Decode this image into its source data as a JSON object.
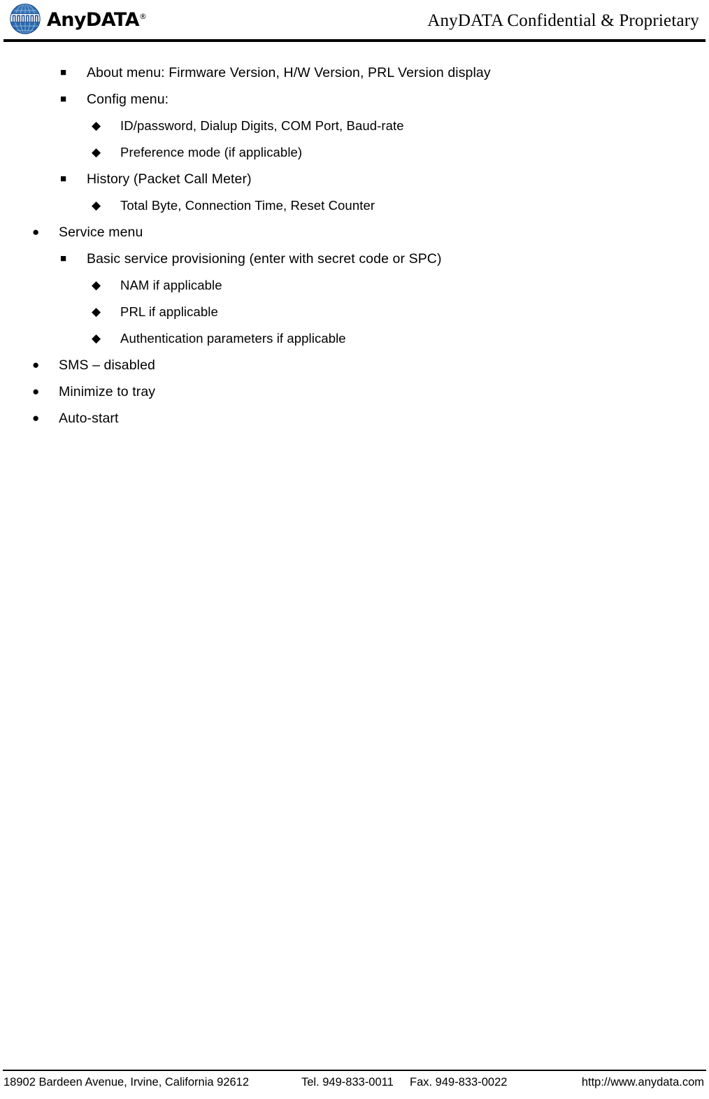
{
  "document": {
    "page_background": "#ffffff",
    "text_color": "#000000"
  },
  "header": {
    "logo": {
      "icon_name": "globe-icon",
      "wordmark": "AnyDATA",
      "registered_mark": "®",
      "globe_color": "#1f5fa8",
      "globe_highlight": "#5b8fc9",
      "globe_dark": "#143f73"
    },
    "confidential_notice": "AnyDATA Confidential & Proprietary",
    "rule_color": "#000000"
  },
  "content": {
    "bullets": [
      {
        "level": 2,
        "marker": "■",
        "marker_name": "square-bullet-icon",
        "text": "About menu: Firmware Version, H/W Version, PRL Version display"
      },
      {
        "level": 2,
        "marker": "■",
        "marker_name": "square-bullet-icon",
        "text": "Config menu:"
      },
      {
        "level": 3,
        "marker": "◆",
        "marker_name": "diamond-bullet-icon",
        "text": "ID/password, Dialup Digits, COM Port, Baud-rate"
      },
      {
        "level": 3,
        "marker": "◆",
        "marker_name": "diamond-bullet-icon",
        "text": "Preference mode (if applicable)"
      },
      {
        "level": 2,
        "marker": "■",
        "marker_name": "square-bullet-icon",
        "text": "History (Packet Call Meter)"
      },
      {
        "level": 3,
        "marker": "◆",
        "marker_name": "diamond-bullet-icon",
        "text": "Total Byte, Connection Time, Reset Counter"
      },
      {
        "level": 1,
        "marker": "●",
        "marker_name": "circle-bullet-icon",
        "text": "Service menu"
      },
      {
        "level": 2,
        "marker": "■",
        "marker_name": "square-bullet-icon",
        "text": "Basic service provisioning (enter with secret code or SPC)"
      },
      {
        "level": 3,
        "marker": "◆",
        "marker_name": "diamond-bullet-icon",
        "text": "NAM if applicable"
      },
      {
        "level": 3,
        "marker": "◆",
        "marker_name": "diamond-bullet-icon",
        "text": "PRL if applicable"
      },
      {
        "level": 3,
        "marker": "◆",
        "marker_name": "diamond-bullet-icon",
        "text": "Authentication parameters if applicable"
      },
      {
        "level": 1,
        "marker": "●",
        "marker_name": "circle-bullet-icon",
        "text": "SMS – disabled"
      },
      {
        "level": 1,
        "marker": "●",
        "marker_name": "circle-bullet-icon",
        "text": "Minimize to tray"
      },
      {
        "level": 1,
        "marker": "●",
        "marker_name": "circle-bullet-icon",
        "text": "Auto-start"
      }
    ]
  },
  "footer": {
    "address": "18902 Bardeen Avenue, Irvine, California 92612",
    "tel": "Tel. 949-833-0011",
    "fax": "Fax. 949-833-0022",
    "url": "http://www.anydata.com",
    "rule_color": "#000000"
  }
}
